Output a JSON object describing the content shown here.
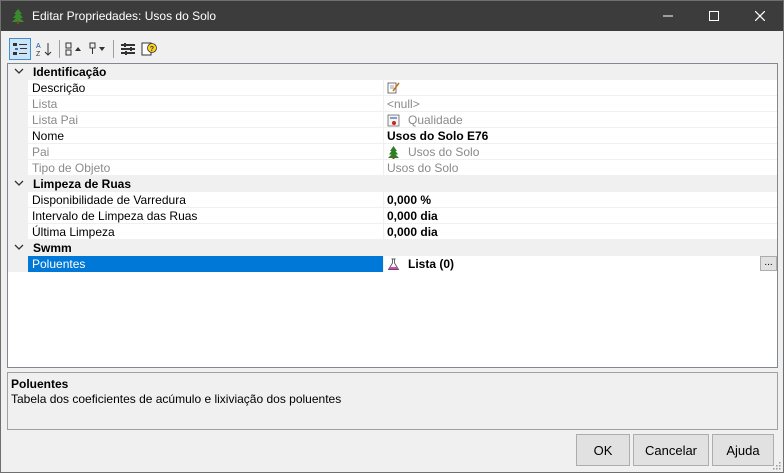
{
  "window": {
    "title": "Editar Propriedades: Usos do Solo",
    "min_icon": "minimize-icon",
    "max_icon": "maximize-icon",
    "close_icon": "close-icon",
    "app_icon": "tree-icon"
  },
  "toolbar": {
    "categorized_icon": "categorized-view-icon",
    "alphabetical_icon": "sort-alphabetical-icon",
    "expand_icon": "expand-all-icon",
    "collapse_icon": "collapse-all-icon",
    "property_pages_icon": "property-pages-icon",
    "help_icon": "help-icon"
  },
  "categories": {
    "identificacao": "Identificação",
    "limpeza": "Limpeza de Ruas",
    "swmm": "Swmm"
  },
  "props": {
    "descricao": {
      "name": "Descrição",
      "value": ""
    },
    "lista": {
      "name": "Lista",
      "value": "<null>"
    },
    "lista_pai": {
      "name": "Lista Pai",
      "value": "Qualidade"
    },
    "nome": {
      "name": "Nome",
      "value": "Usos do Solo E76"
    },
    "pai": {
      "name": "Pai",
      "value": "Usos do Solo"
    },
    "tipo": {
      "name": "Tipo de Objeto",
      "value": "Usos do Solo"
    },
    "disponibilidade": {
      "name": "Disponibilidade de Varredura",
      "value": "0,000 %"
    },
    "intervalo": {
      "name": "Intervalo de Limpeza das Ruas",
      "value": "0,000 dia"
    },
    "ultima": {
      "name": "Última Limpeza",
      "value": "0,000 dia"
    },
    "poluentes": {
      "name": "Poluentes",
      "value": "Lista (0)",
      "button": "..."
    }
  },
  "description": {
    "title": "Poluentes",
    "text": "Tabela dos coeficientes de acúmulo e lixiviação dos poluentes"
  },
  "buttons": {
    "ok": "OK",
    "cancel": "Cancelar",
    "help": "Ajuda"
  },
  "colors": {
    "titlebar": "#3c3c3c",
    "selection": "#0078d7"
  }
}
